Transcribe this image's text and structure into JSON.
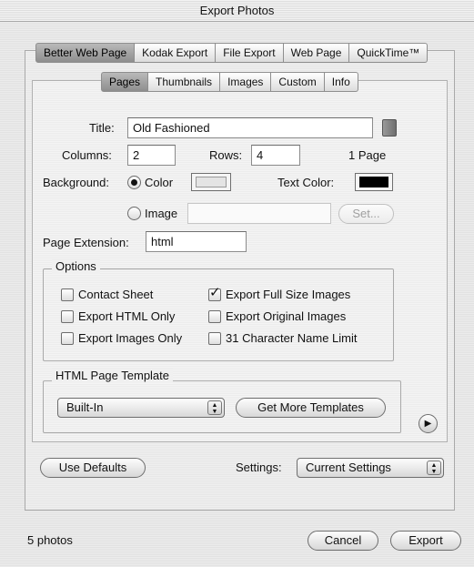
{
  "window": {
    "title": "Export Photos"
  },
  "main_tabs": [
    {
      "label": "Better Web Page",
      "selected": true
    },
    {
      "label": "Kodak Export",
      "selected": false
    },
    {
      "label": "File Export",
      "selected": false
    },
    {
      "label": "Web Page",
      "selected": false
    },
    {
      "label": "QuickTime™",
      "selected": false
    }
  ],
  "sub_tabs": [
    {
      "label": "Pages",
      "selected": true
    },
    {
      "label": "Thumbnails",
      "selected": false
    },
    {
      "label": "Images",
      "selected": false
    },
    {
      "label": "Custom",
      "selected": false
    },
    {
      "label": "Info",
      "selected": false
    }
  ],
  "form": {
    "title_label": "Title:",
    "title_value": "Old Fashioned",
    "columns_label": "Columns:",
    "columns_value": "2",
    "rows_label": "Rows:",
    "rows_value": "4",
    "page_count": "1 Page",
    "background_label": "Background:",
    "color_option": "Color",
    "image_option": "Image",
    "background_mode": "color",
    "background_color": "#e4e4e4",
    "image_path": "",
    "set_button": "Set...",
    "text_color_label": "Text Color:",
    "text_color": "#000000",
    "page_extension_label": "Page Extension:",
    "page_extension_value": "html"
  },
  "options": {
    "legend": "Options",
    "items": [
      {
        "label": "Contact Sheet",
        "checked": false
      },
      {
        "label": "Export Full Size Images",
        "checked": true
      },
      {
        "label": "Export HTML Only",
        "checked": false
      },
      {
        "label": "Export Original Images",
        "checked": false
      },
      {
        "label": "Export Images Only",
        "checked": false
      },
      {
        "label": "31 Character Name Limit",
        "checked": false
      }
    ]
  },
  "template": {
    "legend": "HTML Page Template",
    "selected": "Built-In",
    "more_button": "Get More Templates"
  },
  "footer": {
    "use_defaults": "Use Defaults",
    "settings_label": "Settings:",
    "settings_value": "Current Settings",
    "photo_count": "5 photos",
    "cancel": "Cancel",
    "export": "Export"
  },
  "colors": {
    "selected_tab": "#a3a3a3",
    "field_border": "#8b8b8b"
  }
}
